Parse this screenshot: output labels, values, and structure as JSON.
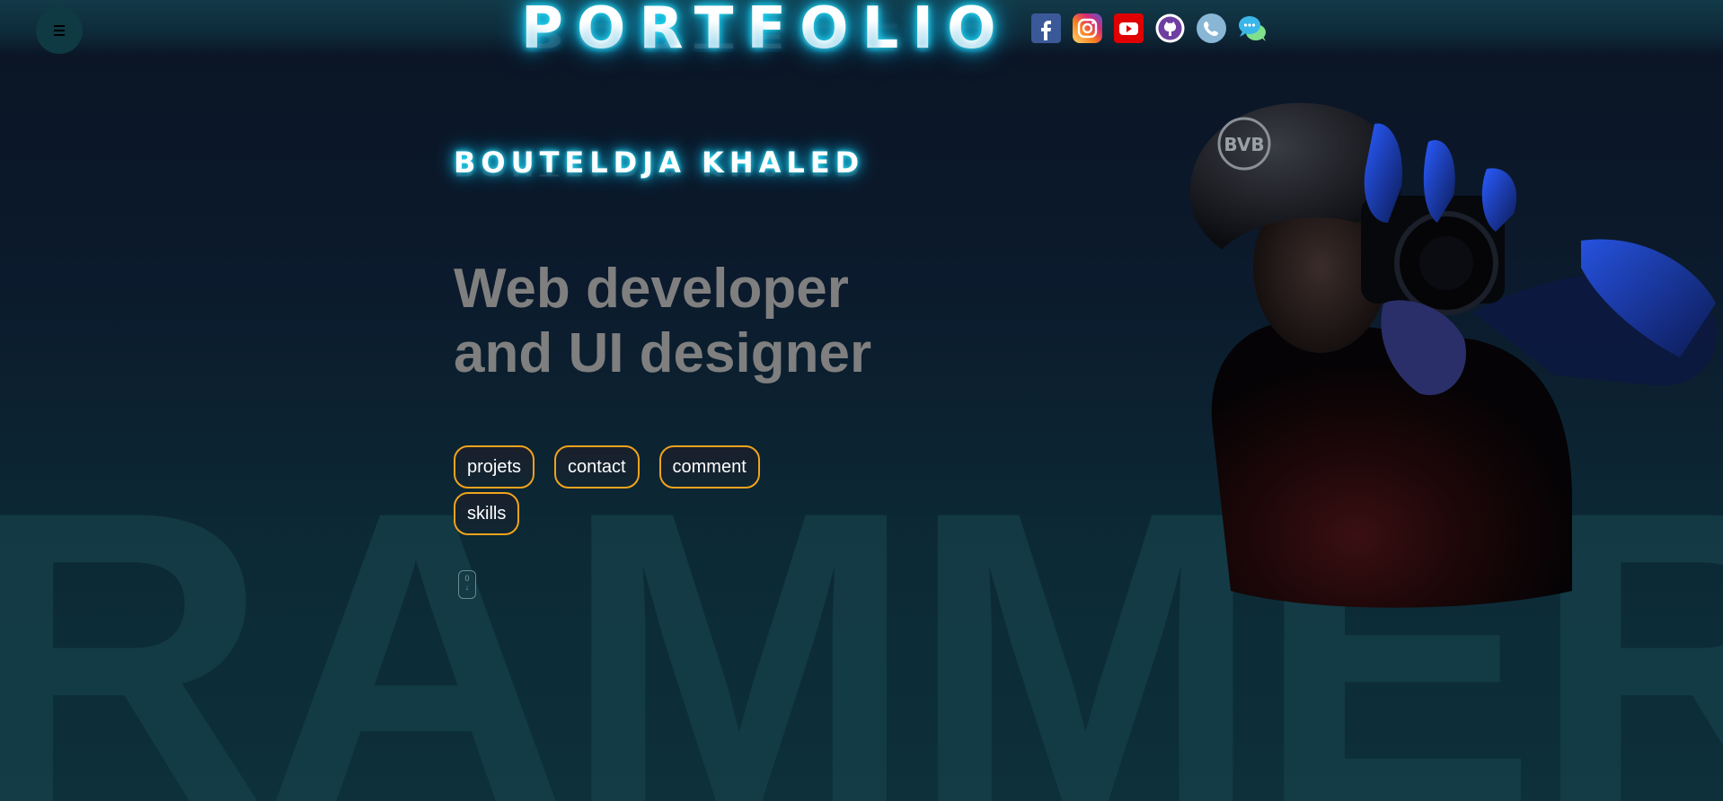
{
  "header": {
    "logo_text": "PORTFOLIO",
    "social_icons": [
      {
        "name": "facebook-icon",
        "color": "#3b5998"
      },
      {
        "name": "instagram-icon",
        "color": "#d62976"
      },
      {
        "name": "youtube-icon",
        "color": "#e00000"
      },
      {
        "name": "github-icon",
        "color": "#6e3fa0"
      },
      {
        "name": "phone-icon",
        "color": "#8ab6d6"
      },
      {
        "name": "chat-icon",
        "color": "#3ab7e8"
      }
    ]
  },
  "hero": {
    "name": "BOUTELDJA KHALED",
    "headline_line1": "Web developer",
    "headline_line2": "and UI designer",
    "nav_buttons": [
      "projets",
      "contact",
      "comment",
      "skills"
    ],
    "scroll_hint": {
      "top": "0",
      "arrow": "↓"
    }
  },
  "background": {
    "watermark": "RAMMER"
  },
  "colors": {
    "accent_border": "#f0a31c",
    "glow": "#16c8f0",
    "headline": "#7f7f7f"
  }
}
